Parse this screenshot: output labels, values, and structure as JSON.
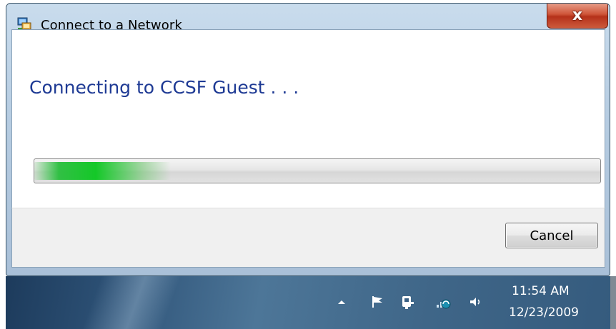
{
  "window": {
    "title": "Connect to a Network",
    "close_symbol": "x",
    "icon": "network-icon"
  },
  "dialog": {
    "heading": "Connecting to CCSF Guest . . .",
    "progress": {
      "value": 0.24,
      "color": "#1fc83a"
    },
    "cancel_label": "Cancel"
  },
  "taskbar": {
    "tray_icons": [
      "show-hidden-icons-arrow",
      "action-center-flag-icon",
      "power-plug-icon",
      "network-icon",
      "volume-icon"
    ],
    "time": "11:54 AM",
    "date": "12/23/2009"
  },
  "colors": {
    "heading": "#1e3a94",
    "close_button": "#c5452b",
    "taskbar": "#3a6084"
  }
}
